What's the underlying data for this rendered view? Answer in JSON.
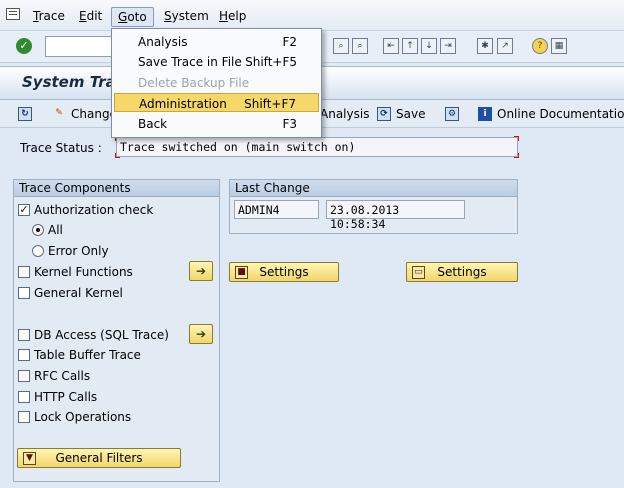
{
  "menubar": {
    "items": [
      {
        "label": "Trace",
        "key": "T"
      },
      {
        "label": "Edit",
        "key": "E"
      },
      {
        "label": "Goto",
        "key": "G"
      },
      {
        "label": "System",
        "key": "S"
      },
      {
        "label": "Help",
        "key": "H"
      }
    ],
    "active": "Goto"
  },
  "goto_menu": {
    "items": [
      {
        "label": "Analysis",
        "shortcut": "F2",
        "enabled": true
      },
      {
        "label": "Save Trace in File",
        "shortcut": "Shift+F5",
        "enabled": true
      },
      {
        "label": "Delete Backup File",
        "shortcut": "",
        "enabled": false
      },
      {
        "label": "Administration",
        "shortcut": "Shift+F7",
        "enabled": true,
        "highlighted": true
      },
      {
        "label": "Back",
        "shortcut": "F3",
        "enabled": true
      }
    ]
  },
  "page": {
    "title": "System Tra"
  },
  "app_toolbar": {
    "change": "Change",
    "analysis": "Analysis",
    "save": "Save",
    "online_doc": "Online Documentation"
  },
  "trace_status": {
    "label": "Trace Status :",
    "value": "Trace switched on (main switch on)"
  },
  "trace_components": {
    "title": "Trace Components",
    "authorization_check": {
      "label": "Authorization check",
      "checked": true
    },
    "radio_all": {
      "label": "All",
      "selected": true
    },
    "radio_errors": {
      "label": "Error Only",
      "selected": false
    },
    "kernel_functions": {
      "label": "Kernel Functions",
      "checked": false
    },
    "general_kernel": {
      "label": "General Kernel",
      "checked": false
    },
    "db_access": {
      "label": "DB Access (SQL Trace)",
      "checked": false
    },
    "table_buffer": {
      "label": "Table Buffer Trace",
      "checked": false
    },
    "rfc_calls": {
      "label": "RFC Calls",
      "checked": false
    },
    "http_calls": {
      "label": "HTTP Calls",
      "checked": false
    },
    "lock_operations": {
      "label": "Lock Operations",
      "checked": false
    },
    "general_filters": "General Filters"
  },
  "last_change": {
    "title": "Last Change",
    "user": "ADMIN4",
    "timestamp": "23.08.2013 10:58:34"
  },
  "settings_buttons": {
    "left": "Settings",
    "right": "Settings"
  },
  "colors": {
    "button_yellow": "#f2d66a",
    "menu_highlight": "#f5d76a",
    "required_marker": "#d01010"
  }
}
